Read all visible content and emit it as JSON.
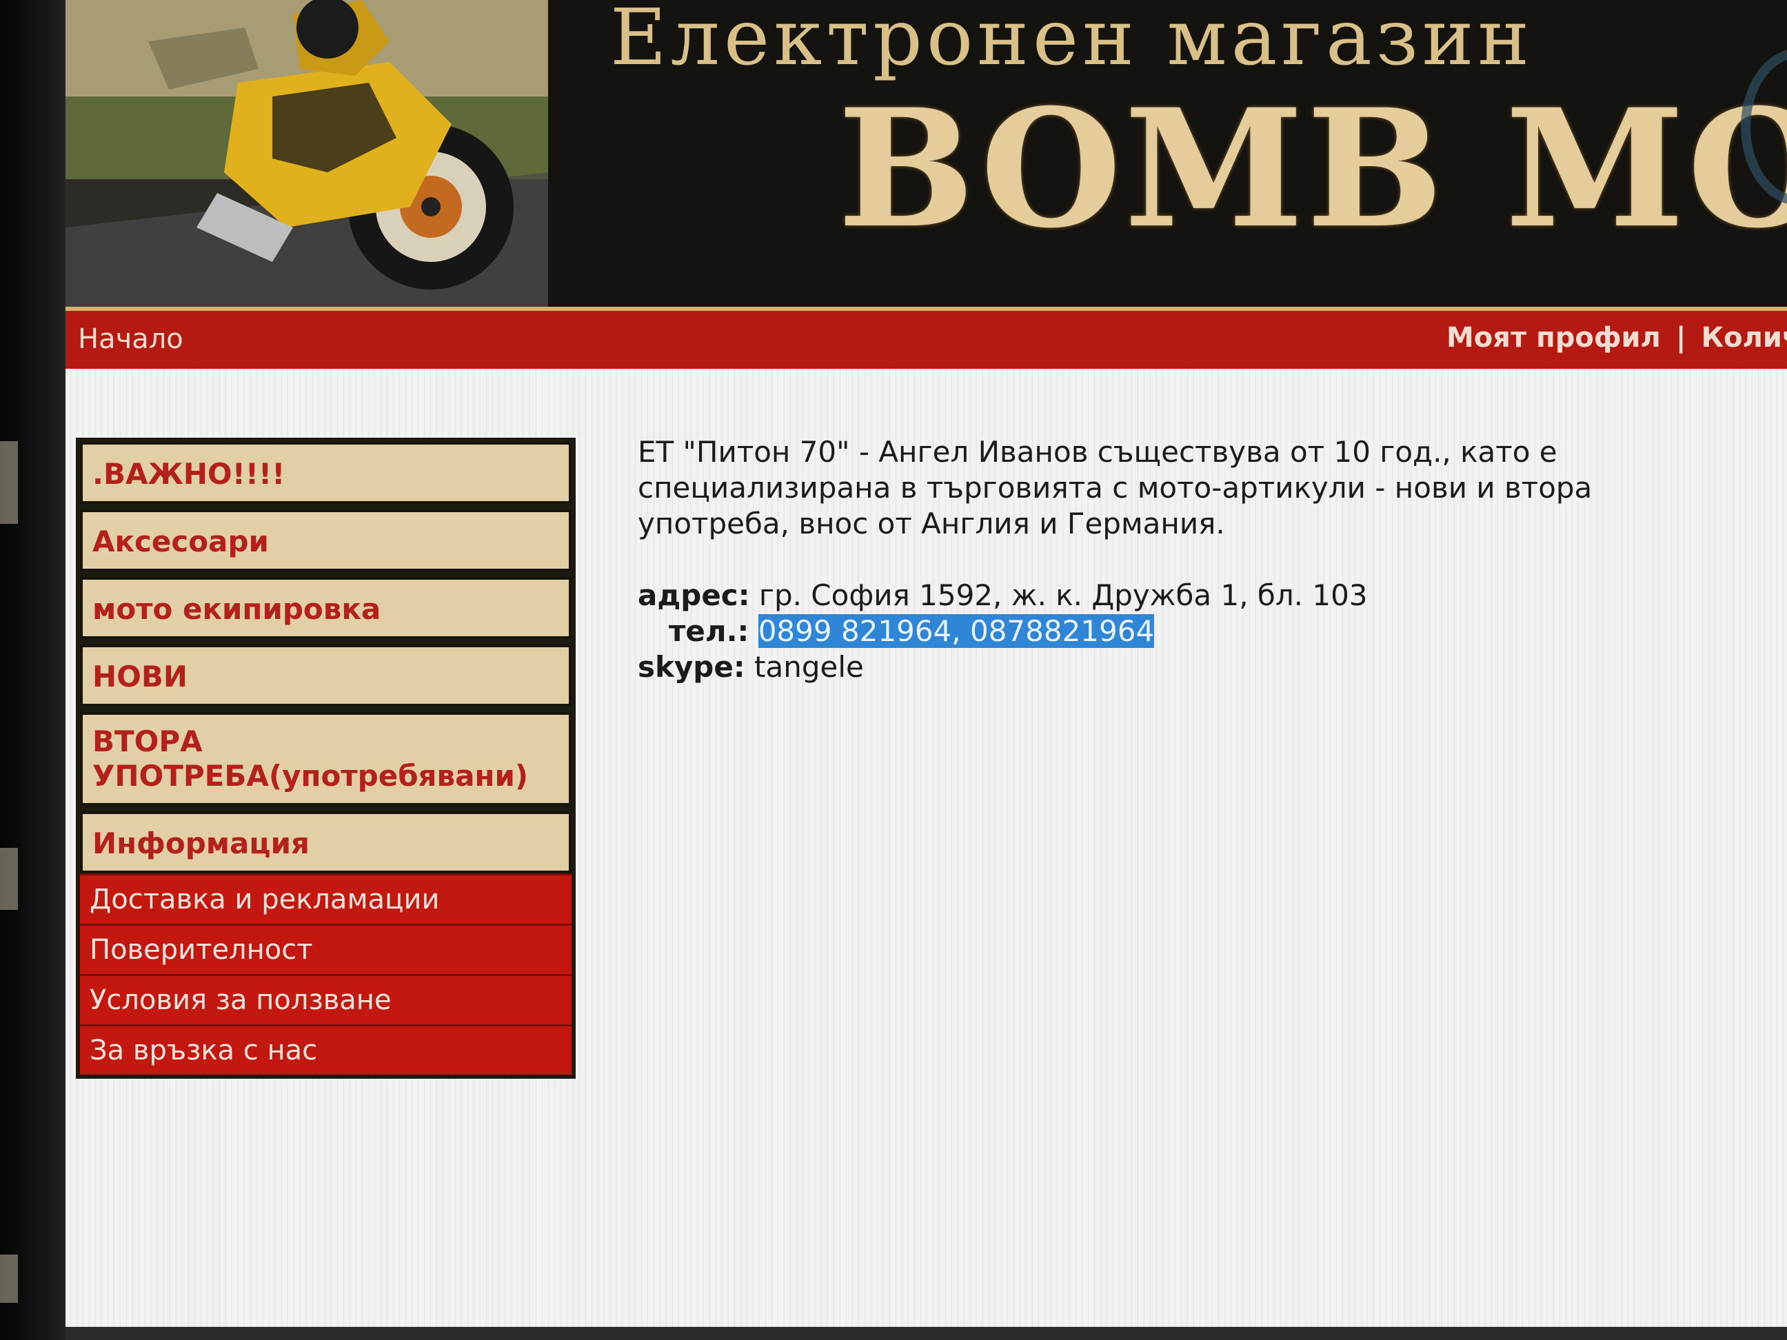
{
  "header": {
    "store_line": "Електронен магазин",
    "brand": "BOMB MOTO"
  },
  "nav": {
    "home": "Начало",
    "profile": "Моят профил",
    "separator": "|",
    "cart_partial": "Количк"
  },
  "sidebar": {
    "categories": [
      {
        "label": ".ВАЖНО!!!!"
      },
      {
        "label": "Аксесоари"
      },
      {
        "label": "мото екипировка"
      },
      {
        "label": "НОВИ"
      },
      {
        "label": "ВТОРА УПОТРЕБА(употребявани)"
      },
      {
        "label": "Информация"
      }
    ],
    "info_links": [
      {
        "label": "Доставка и рекламации"
      },
      {
        "label": "Поверителност"
      },
      {
        "label": "Условия за ползване"
      },
      {
        "label": "За връзка с нас"
      }
    ]
  },
  "main": {
    "intro_lines": [
      "ЕТ \"Питон 70\" - Ангел Иванов съществува от 10 год., като е",
      "специализирана в търговията с мото-артикули - нови и втора",
      "употреба, внос от Англия и Германия."
    ],
    "address_label": "адрес:",
    "address_value": "гр. София 1592, ж. к. Дружба 1, бл. 103",
    "phone_label": "тел.:",
    "phone_value": "0899 821964, 0878821964",
    "skype_label": "skype:",
    "skype_value": "tangele"
  },
  "colors": {
    "nav_red": "#b41a12",
    "menu_beige": "#e3cfa6",
    "menu_text_red": "#b3211a",
    "selection_blue": "#2f86d6",
    "brand_gold": "#e4cd9a"
  }
}
